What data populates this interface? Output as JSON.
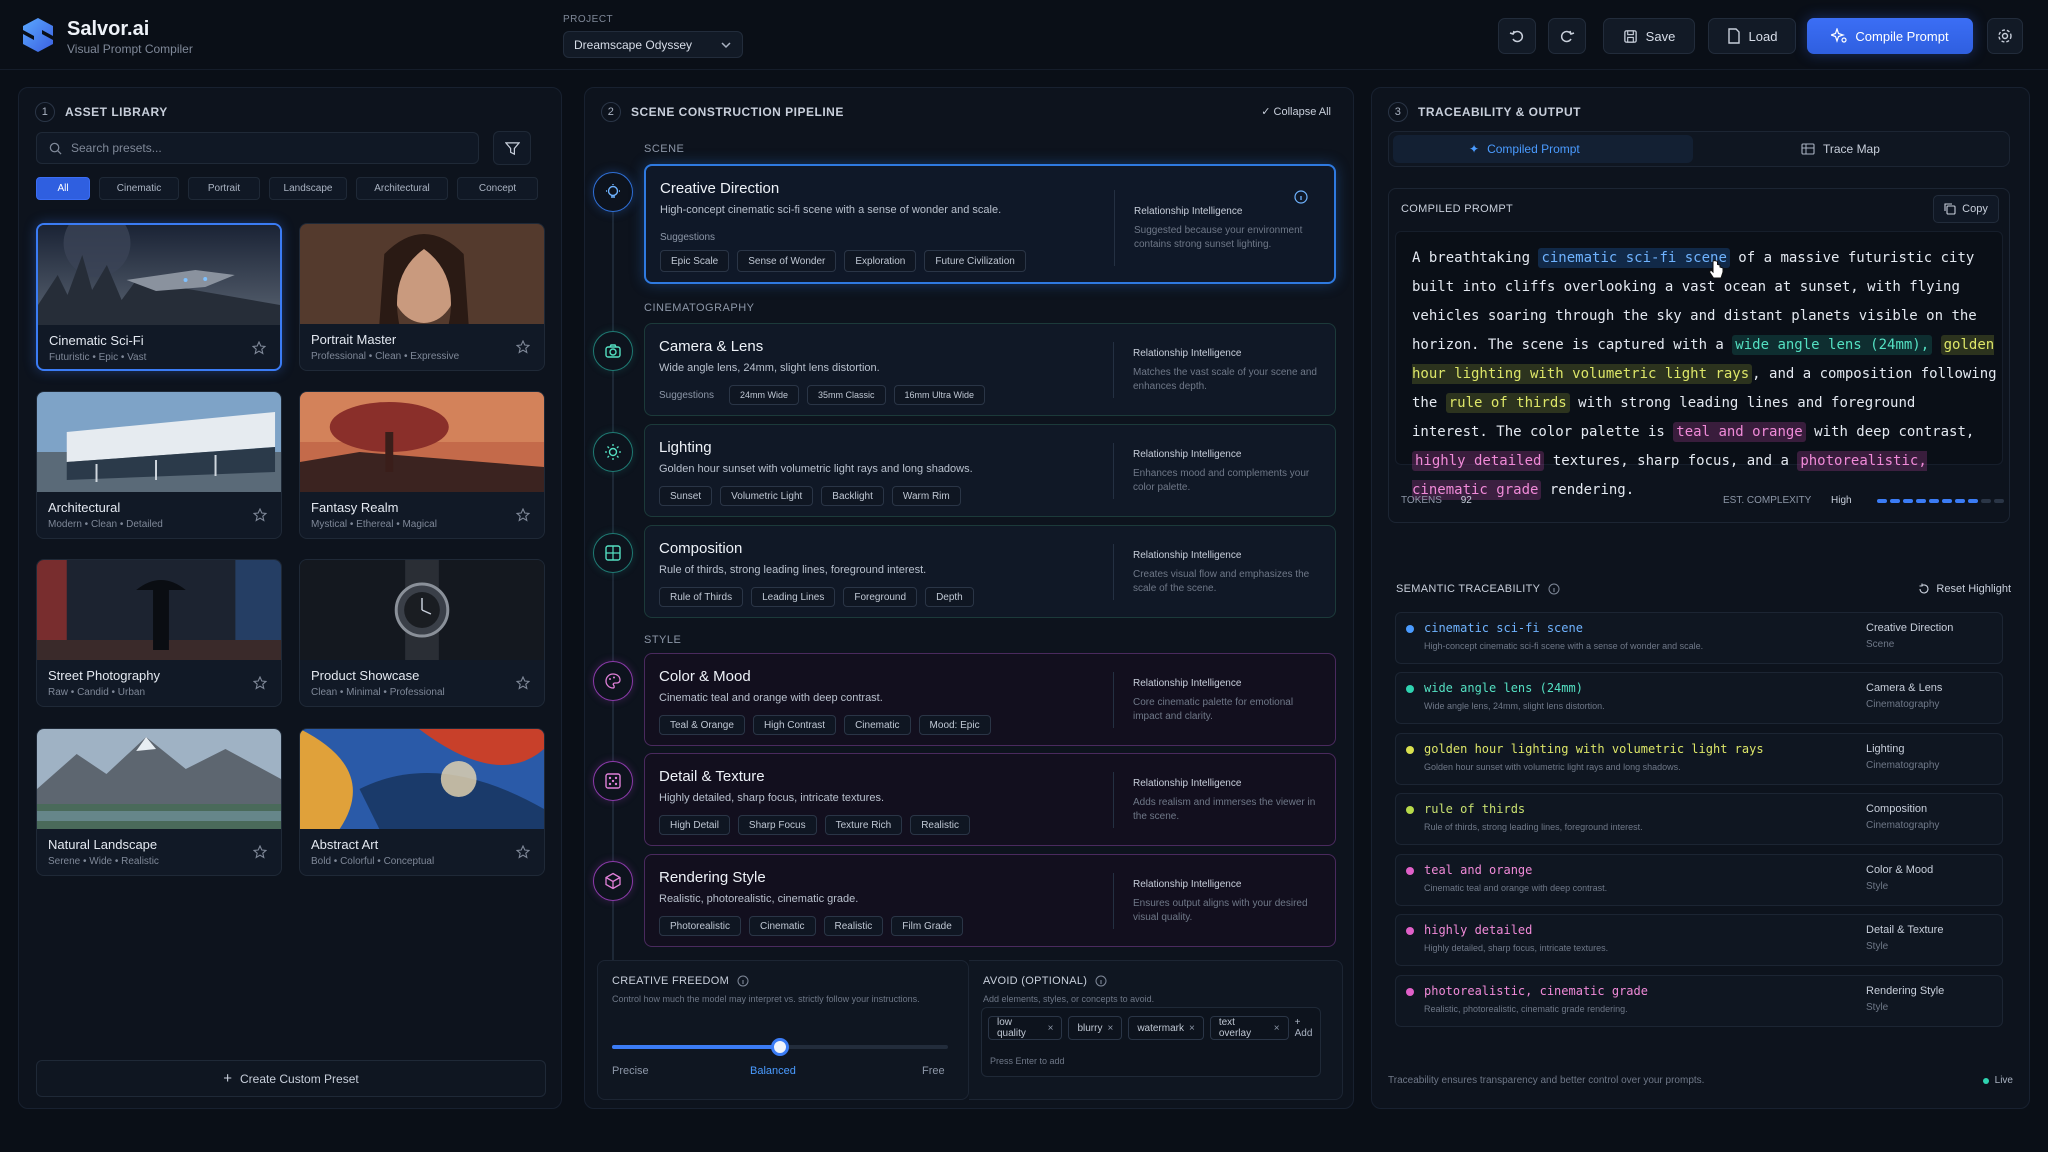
{
  "brand": {
    "name": "Salvor.ai",
    "tagline": "Visual Prompt Compiler"
  },
  "project": {
    "label": "PROJECT",
    "value": "Dreamscape Odyssey"
  },
  "toolbar": {
    "save": "Save",
    "load": "Load",
    "compile": "Compile Prompt"
  },
  "asset_library": {
    "step": "1",
    "title": "ASSET LIBRARY",
    "search_placeholder": "Search presets...",
    "filters": [
      "All",
      "Cinematic",
      "Portrait",
      "Landscape",
      "Architectural",
      "Concept"
    ],
    "presets": [
      {
        "title": "Cinematic Sci-Fi",
        "tags": "Futuristic • Epic • Vast"
      },
      {
        "title": "Portrait Master",
        "tags": "Professional • Clean • Expressive"
      },
      {
        "title": "Architectural",
        "tags": "Modern • Clean • Detailed"
      },
      {
        "title": "Fantasy Realm",
        "tags": "Mystical • Ethereal • Magical"
      },
      {
        "title": "Street Photography",
        "tags": "Raw • Candid • Urban"
      },
      {
        "title": "Product Showcase",
        "tags": "Clean • Minimal • Professional"
      },
      {
        "title": "Natural Landscape",
        "tags": "Serene • Wide • Realistic"
      },
      {
        "title": "Abstract Art",
        "tags": "Bold • Colorful • Conceptual"
      }
    ],
    "create_custom": "Create Custom Preset"
  },
  "pipeline": {
    "step": "2",
    "title": "SCENE CONSTRUCTION PIPELINE",
    "collapse_all": "Collapse All",
    "groups": {
      "scene": "SCENE",
      "cinematography": "CINEMATOGRAPHY",
      "style": "STYLE"
    },
    "suggestions_label": "Suggestions",
    "relationship_label": "Relationship Intelligence",
    "steps": [
      {
        "title": "Creative Direction",
        "desc": "High-concept cinematic sci-fi scene with a sense of wonder and scale.",
        "tags": [
          "Epic Scale",
          "Sense of Wonder",
          "Exploration",
          "Future Civilization"
        ],
        "rel": "Suggested because your environment contains strong sunset lighting."
      },
      {
        "title": "Camera & Lens",
        "desc": "Wide angle lens, 24mm, slight lens distortion.",
        "tags": [
          "24mm Wide",
          "35mm Classic",
          "16mm Ultra Wide"
        ],
        "rel": "Matches the vast scale of your scene and enhances depth."
      },
      {
        "title": "Lighting",
        "desc": "Golden hour sunset with volumetric light rays and long shadows.",
        "tags": [
          "Sunset",
          "Volumetric Light",
          "Backlight",
          "Warm Rim"
        ],
        "rel": "Enhances mood and complements your color palette."
      },
      {
        "title": "Composition",
        "desc": "Rule of thirds, strong leading lines, foreground interest.",
        "tags": [
          "Rule of Thirds",
          "Leading Lines",
          "Foreground",
          "Depth"
        ],
        "rel": "Creates visual flow and emphasizes the scale of the scene."
      },
      {
        "title": "Color & Mood",
        "desc": "Cinematic teal and orange with deep contrast.",
        "tags": [
          "Teal & Orange",
          "High Contrast",
          "Cinematic",
          "Mood: Epic"
        ],
        "rel": "Core cinematic palette for emotional impact and clarity."
      },
      {
        "title": "Detail & Texture",
        "desc": "Highly detailed, sharp focus, intricate textures.",
        "tags": [
          "High Detail",
          "Sharp Focus",
          "Texture Rich",
          "Realistic"
        ],
        "rel": "Adds realism and immerses the viewer in the scene."
      },
      {
        "title": "Rendering Style",
        "desc": "Realistic, photorealistic, cinematic grade.",
        "tags": [
          "Photorealistic",
          "Cinematic",
          "Realistic",
          "Film Grade"
        ],
        "rel": "Ensures output aligns with your desired visual quality."
      }
    ],
    "freedom": {
      "title": "CREATIVE FREEDOM",
      "sub": "Control how much the model may interpret vs. strictly follow your instructions.",
      "min": "Precise",
      "mid": "Balanced",
      "max": "Free",
      "value": 0.5
    },
    "avoid": {
      "title": "AVOID (OPTIONAL)",
      "sub": "Add elements, styles, or concepts to avoid.",
      "items": [
        "low quality",
        "blurry",
        "watermark",
        "text overlay"
      ],
      "add": "+ Add",
      "hint": "Press Enter to add"
    }
  },
  "output": {
    "step": "3",
    "title": "TRACEABILITY & OUTPUT",
    "tabs": [
      "Compiled Prompt",
      "Trace Map"
    ],
    "compiled_title": "COMPILED PROMPT",
    "copy": "Copy",
    "prompt": {
      "p1": "A breathtaking ",
      "h1": "cinematic sci-fi scene",
      "p2": " of a massive futuristic city built into cliffs overlooking a vast ocean at sunset, with flying vehicles soaring through the sky and distant planets visible on the horizon. The scene is captured with a ",
      "h2": "wide angle lens (24mm),",
      "p3": " ",
      "h3": "golden hour lighting with volumetric light rays",
      "p4": ", and a composition following the ",
      "h4": "rule of thirds",
      "p5": " with strong leading lines and foreground interest. The color palette is ",
      "h5": "teal and orange",
      "p6": " with deep contrast, ",
      "h6": "highly detailed",
      "p7": " textures, sharp focus, and a ",
      "h7": "photorealistic, cinematic grade",
      "p8": " rendering."
    },
    "tokens_label": "TOKENS",
    "tokens": "92",
    "complexity_label": "EST. COMPLEXITY",
    "complexity": "High",
    "complexity_level": 0.8,
    "trace_title": "SEMANTIC TRACEABILITY",
    "reset": "Reset Highlight",
    "trace": [
      {
        "phrase": "cinematic sci-fi scene",
        "desc": "High-concept cinematic sci-fi scene with a sense of wonder and scale.",
        "cat": "Creative Direction",
        "sub": "Scene",
        "color": "#4a9bff"
      },
      {
        "phrase": "wide angle lens (24mm)",
        "desc": "Wide angle lens, 24mm, slight lens distortion.",
        "cat": "Camera & Lens",
        "sub": "Cinematography",
        "color": "#2fd3b0"
      },
      {
        "phrase": "golden hour lighting with volumetric light rays",
        "desc": "Golden hour sunset with volumetric light rays and long shadows.",
        "cat": "Lighting",
        "sub": "Cinematography",
        "color": "#d9e04f"
      },
      {
        "phrase": "rule of thirds",
        "desc": "Rule of thirds, strong leading lines, foreground interest.",
        "cat": "Composition",
        "sub": "Cinematography",
        "color": "#b7d94a"
      },
      {
        "phrase": "teal and orange",
        "desc": "Cinematic teal and orange with deep contrast.",
        "cat": "Color & Mood",
        "sub": "Style",
        "color": "#e060c8"
      },
      {
        "phrase": "highly detailed",
        "desc": "Highly detailed, sharp focus, intricate textures.",
        "cat": "Detail & Texture",
        "sub": "Style",
        "color": "#e060c8"
      },
      {
        "phrase": "photorealistic, cinematic grade",
        "desc": "Realistic, photorealistic, cinematic grade rendering.",
        "cat": "Rendering Style",
        "sub": "Style",
        "color": "#e060c8"
      }
    ],
    "footer": "Traceability ensures transparency and better control over your prompts.",
    "live": "Live"
  }
}
